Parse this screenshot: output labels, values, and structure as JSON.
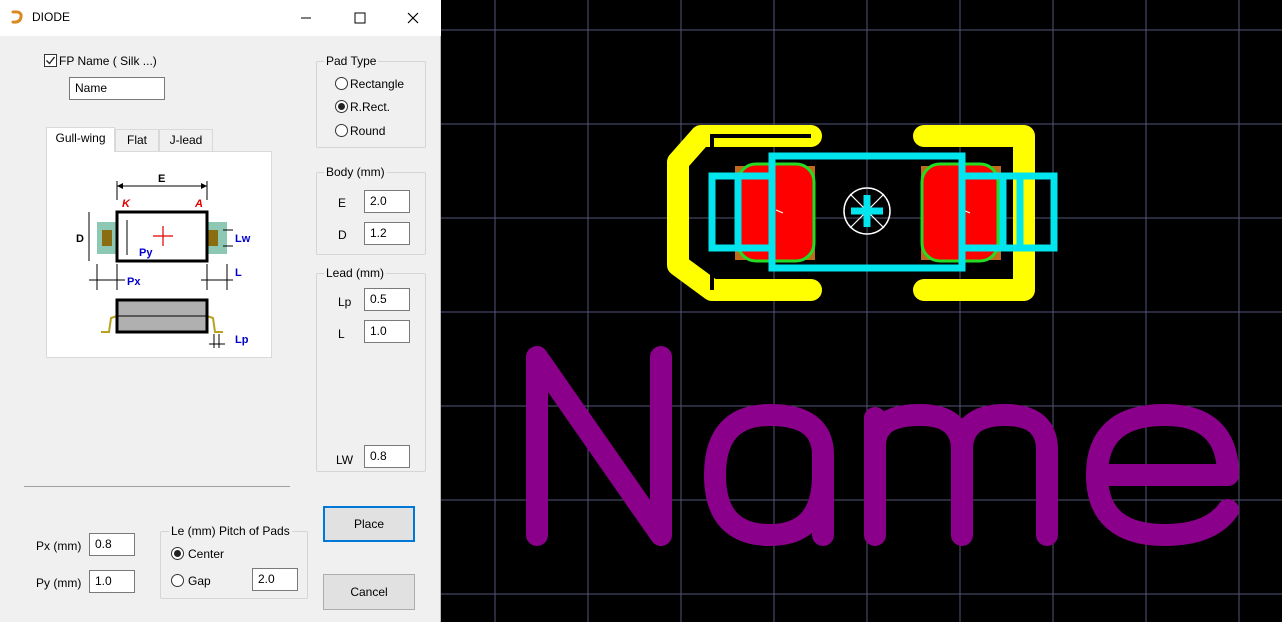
{
  "window": {
    "title": "DIODE",
    "minimize": "–",
    "maximize": "☐",
    "close": "✕"
  },
  "fp_name": {
    "label": "FP Name ( Silk ...)",
    "checked": true,
    "value": "Name"
  },
  "tabs": [
    {
      "label": "Gull-wing"
    },
    {
      "label": "Flat"
    },
    {
      "label": "J-lead"
    }
  ],
  "diagram": {
    "E": "E",
    "K": "K",
    "A": "A",
    "D": "D",
    "Py": "Py",
    "Px": "Px",
    "Lw": "Lw",
    "L": "L",
    "Lp": "Lp"
  },
  "pad_type": {
    "title": "Pad Type",
    "options": [
      {
        "label": "Rectangle"
      },
      {
        "label": "R.Rect."
      },
      {
        "label": "Round"
      }
    ],
    "selected": "R.Rect."
  },
  "body": {
    "title": "Body (mm)",
    "E_label": "E",
    "E": "2.0",
    "D_label": "D",
    "D": "1.2"
  },
  "lead": {
    "title": "Lead (mm)",
    "Lp_label": "Lp",
    "Lp": "0.5",
    "L_label": "L",
    "L": "1.0",
    "LW_label": "LW",
    "LW": "0.8"
  },
  "pads": {
    "px_label": "Px (mm)",
    "px": "0.8",
    "py_label": "Py (mm)",
    "py": "1.0"
  },
  "pitch": {
    "title": "Le (mm)  Pitch of Pads",
    "center_label": "Center",
    "gap_label": "Gap",
    "selected": "Center",
    "value": "2.0"
  },
  "buttons": {
    "place": "Place",
    "cancel": "Cancel"
  },
  "canvas": {
    "silk_name": "Name",
    "colors": {
      "background": "#000000",
      "grid": "#55557a",
      "courtyard": "#ffff00",
      "body_outline": "#00e5ee",
      "pad": "#ff0000",
      "pad_outline": "#22dd22",
      "silk_text": "#8b008b"
    }
  }
}
